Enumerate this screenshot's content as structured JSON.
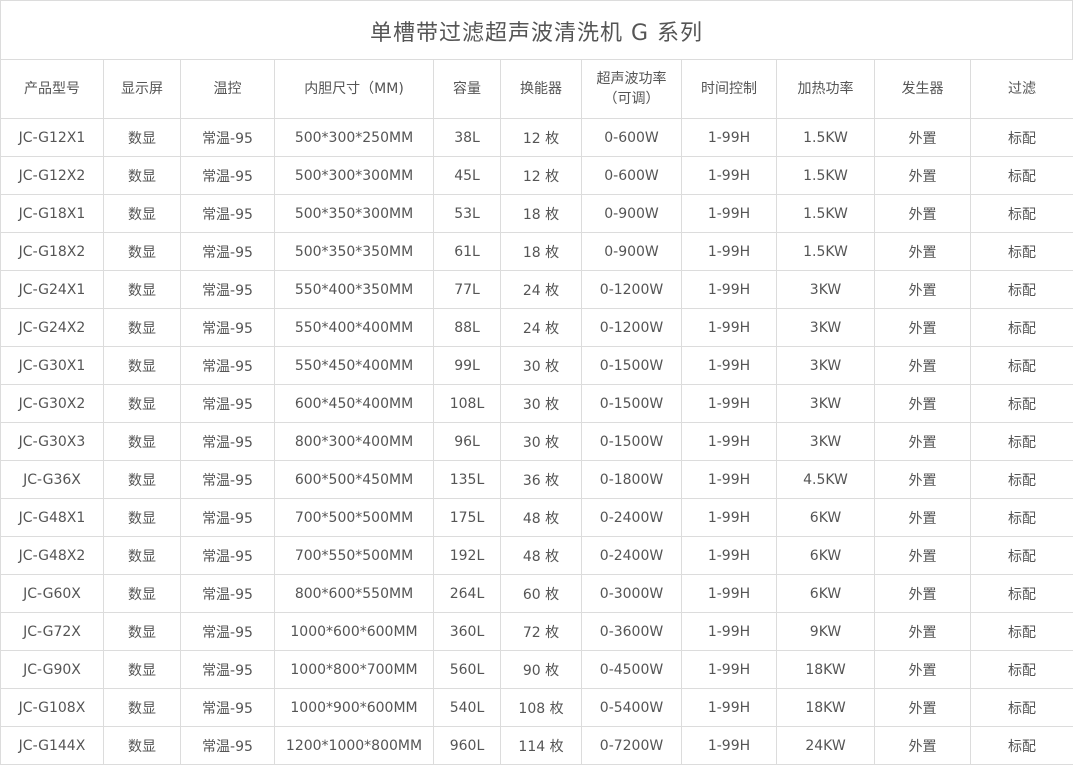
{
  "title": "单槽带过滤超声波清洗机 G 系列",
  "columns": [
    "产品型号",
    "显示屏",
    "温控",
    "内胆尺寸（MM)",
    "容量",
    "换能器",
    "超声波功率（可调）",
    "时间控制",
    "加热功率",
    "发生器",
    "过滤"
  ],
  "rows": [
    [
      "JC-G12X1",
      "数显",
      "常温-95",
      "500*300*250MM",
      "38L",
      "12 枚",
      "0-600W",
      "1-99H",
      "1.5KW",
      "外置",
      "标配"
    ],
    [
      "JC-G12X2",
      "数显",
      "常温-95",
      "500*300*300MM",
      "45L",
      "12 枚",
      "0-600W",
      "1-99H",
      "1.5KW",
      "外置",
      "标配"
    ],
    [
      "JC-G18X1",
      "数显",
      "常温-95",
      "500*350*300MM",
      "53L",
      "18 枚",
      "0-900W",
      "1-99H",
      "1.5KW",
      "外置",
      "标配"
    ],
    [
      "JC-G18X2",
      "数显",
      "常温-95",
      "500*350*350MM",
      "61L",
      "18 枚",
      "0-900W",
      "1-99H",
      "1.5KW",
      "外置",
      "标配"
    ],
    [
      "JC-G24X1",
      "数显",
      "常温-95",
      "550*400*350MM",
      "77L",
      "24 枚",
      "0-1200W",
      "1-99H",
      "3KW",
      "外置",
      "标配"
    ],
    [
      "JC-G24X2",
      "数显",
      "常温-95",
      "550*400*400MM",
      "88L",
      "24 枚",
      "0-1200W",
      "1-99H",
      "3KW",
      "外置",
      "标配"
    ],
    [
      "JC-G30X1",
      "数显",
      "常温-95",
      "550*450*400MM",
      "99L",
      "30 枚",
      "0-1500W",
      "1-99H",
      "3KW",
      "外置",
      "标配"
    ],
    [
      "JC-G30X2",
      "数显",
      "常温-95",
      "600*450*400MM",
      "108L",
      "30 枚",
      "0-1500W",
      "1-99H",
      "3KW",
      "外置",
      "标配"
    ],
    [
      "JC-G30X3",
      "数显",
      "常温-95",
      "800*300*400MM",
      "96L",
      "30 枚",
      "0-1500W",
      "1-99H",
      "3KW",
      "外置",
      "标配"
    ],
    [
      "JC-G36X",
      "数显",
      "常温-95",
      "600*500*450MM",
      "135L",
      "36 枚",
      "0-1800W",
      "1-99H",
      "4.5KW",
      "外置",
      "标配"
    ],
    [
      "JC-G48X1",
      "数显",
      "常温-95",
      "700*500*500MM",
      "175L",
      "48 枚",
      "0-2400W",
      "1-99H",
      "6KW",
      "外置",
      "标配"
    ],
    [
      "JC-G48X2",
      "数显",
      "常温-95",
      "700*550*500MM",
      "192L",
      "48 枚",
      "0-2400W",
      "1-99H",
      "6KW",
      "外置",
      "标配"
    ],
    [
      "JC-G60X",
      "数显",
      "常温-95",
      "800*600*550MM",
      "264L",
      "60 枚",
      "0-3000W",
      "1-99H",
      "6KW",
      "外置",
      "标配"
    ],
    [
      "JC-G72X",
      "数显",
      "常温-95",
      "1000*600*600MM",
      "360L",
      "72 枚",
      "0-3600W",
      "1-99H",
      "9KW",
      "外置",
      "标配"
    ],
    [
      "JC-G90X",
      "数显",
      "常温-95",
      "1000*800*700MM",
      "560L",
      "90 枚",
      "0-4500W",
      "1-99H",
      "18KW",
      "外置",
      "标配"
    ],
    [
      "JC-G108X",
      "数显",
      "常温-95",
      "1000*900*600MM",
      "540L",
      "108 枚",
      "0-5400W",
      "1-99H",
      "18KW",
      "外置",
      "标配"
    ],
    [
      "JC-G144X",
      "数显",
      "常温-95",
      "1200*1000*800MM",
      "960L",
      "114 枚",
      "0-7200W",
      "1-99H",
      "24KW",
      "外置",
      "标配"
    ]
  ]
}
